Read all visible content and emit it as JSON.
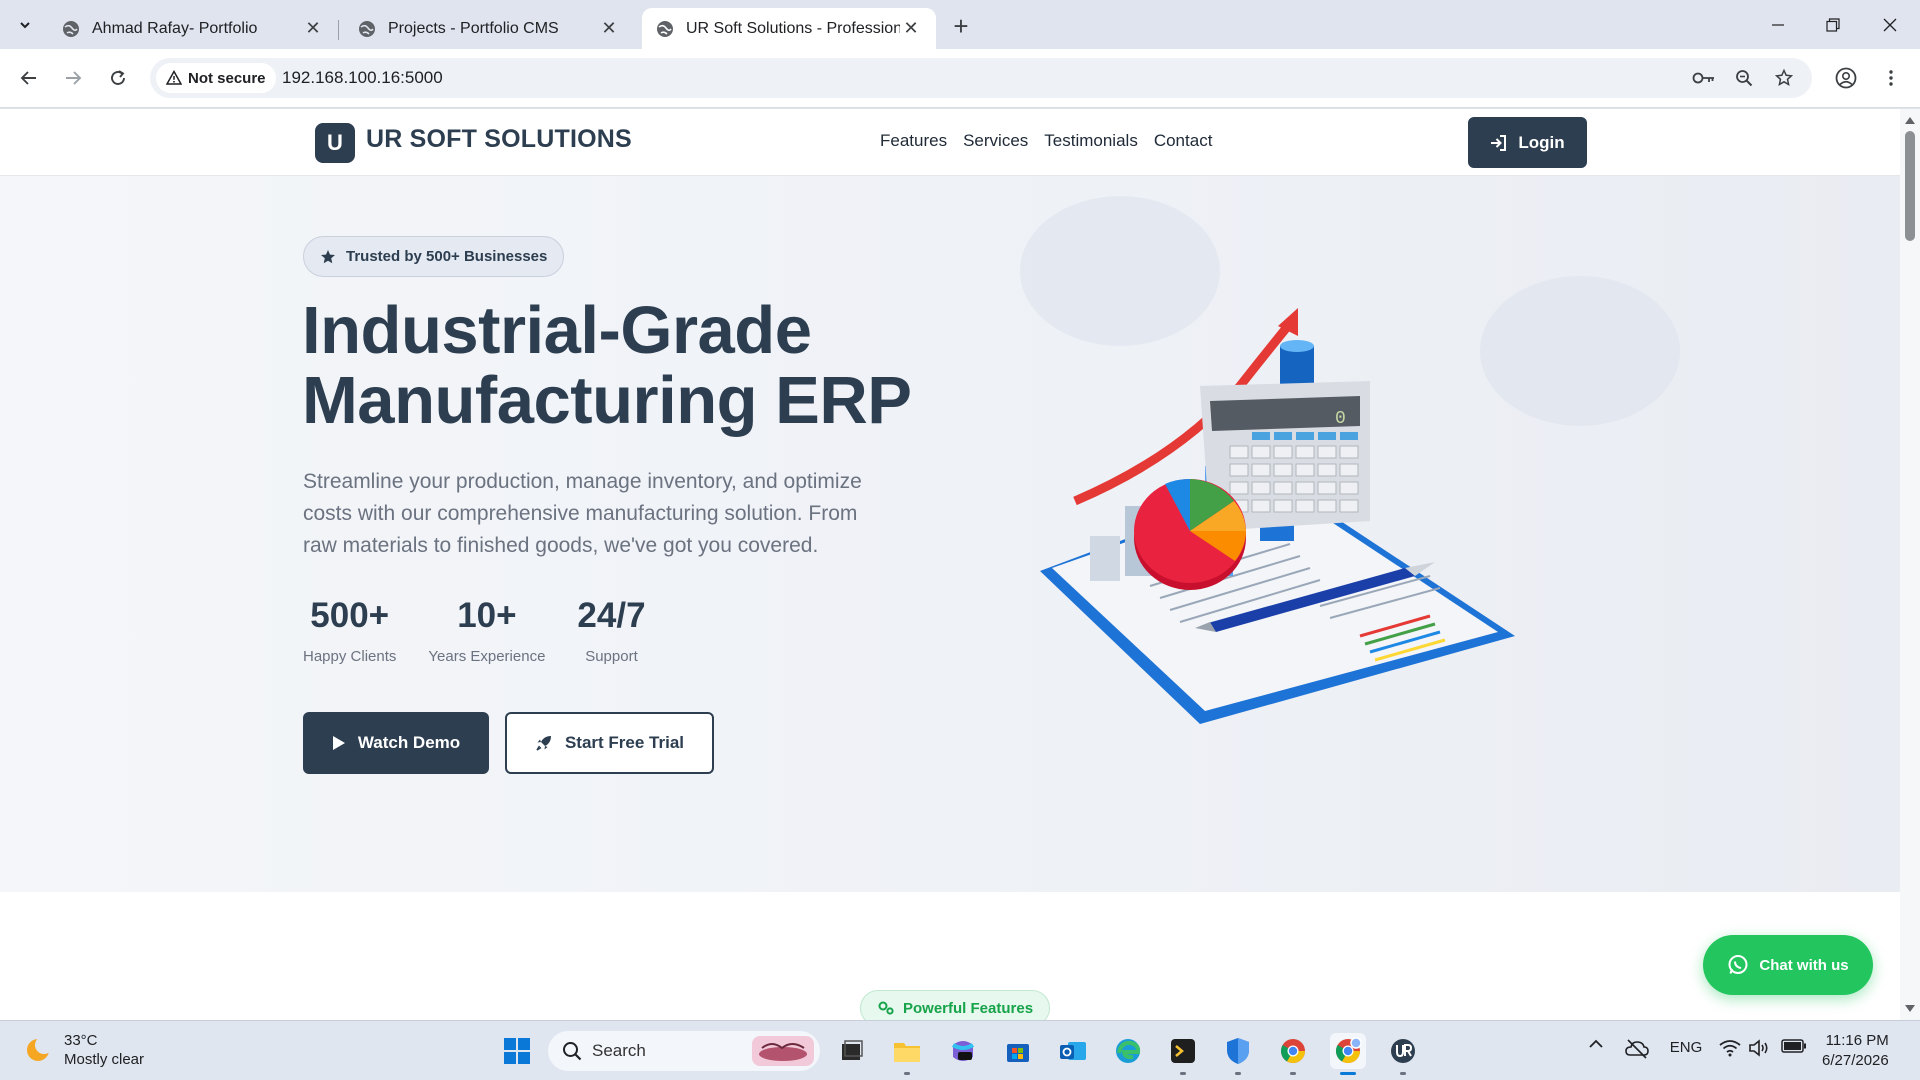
{
  "browser": {
    "tabs": [
      {
        "title": "Ahmad Rafay- Portfolio",
        "active": false
      },
      {
        "title": "Projects - Portfolio CMS",
        "active": false
      },
      {
        "title": "UR Soft Solutions - Professional",
        "active": true
      }
    ],
    "security_label": "Not secure",
    "url": "192.168.100.16:5000"
  },
  "site": {
    "logo_letter": "U",
    "brand": "UR SOFT SOLUTIONS",
    "nav": [
      "Features",
      "Services",
      "Testimonials",
      "Contact"
    ],
    "login_label": "Login",
    "badge": "Trusted by 500+ Businesses",
    "headline_line1": "Industrial-Grade",
    "headline_line2": "Manufacturing ERP",
    "subtext": "Streamline your production, manage inventory, and optimize costs with our comprehensive manufacturing solution. From raw materials to finished goods, we've got you covered.",
    "stats": [
      {
        "value": "500+",
        "label": "Happy Clients"
      },
      {
        "value": "10+",
        "label": "Years Experience"
      },
      {
        "value": "24/7",
        "label": "Support"
      }
    ],
    "watch_demo": "Watch Demo",
    "start_trial": "Start Free Trial",
    "features_pill": "Powerful Features",
    "chat_label": "Chat with us"
  },
  "taskbar": {
    "weather_temp": "33°C",
    "weather_desc": "Mostly clear",
    "search_placeholder": "Search",
    "tray_language": "ENG",
    "time": "11:16 PM",
    "date": "6/27/2026"
  },
  "colors": {
    "brand_dark": "#2d3e50",
    "accent_green": "#22c55e",
    "tab_strip": "#dfe4ee"
  }
}
